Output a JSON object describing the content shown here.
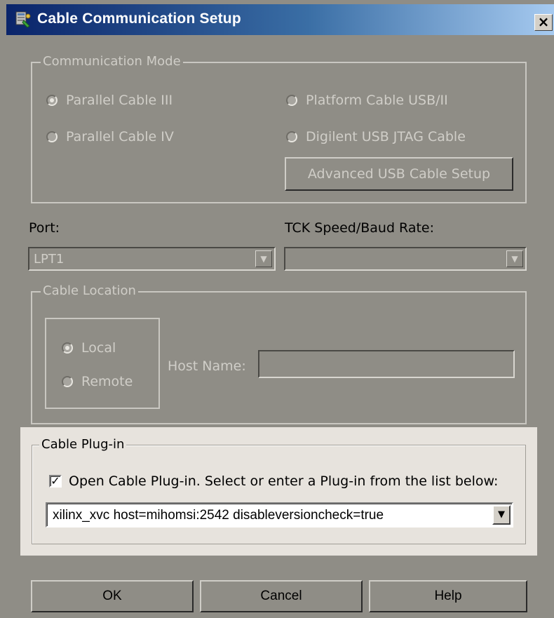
{
  "window": {
    "title": "Cable Communication Setup",
    "close_label": "×"
  },
  "communication_mode": {
    "legend": "Communication Mode",
    "options": [
      {
        "label": "Parallel Cable III",
        "selected": true
      },
      {
        "label": "Parallel Cable IV",
        "selected": false
      },
      {
        "label": "Platform Cable USB/II",
        "selected": false
      },
      {
        "label": "Digilent USB JTAG Cable",
        "selected": false
      }
    ],
    "advanced_button": "Advanced USB Cable Setup"
  },
  "port": {
    "label": "Port:",
    "value": "LPT1"
  },
  "tck_speed": {
    "label": "TCK Speed/Baud Rate:",
    "value": ""
  },
  "cable_location": {
    "legend": "Cable Location",
    "options": [
      {
        "label": "Local",
        "selected": true
      },
      {
        "label": "Remote",
        "selected": false
      }
    ],
    "host_label": "Host Name:",
    "host_value": ""
  },
  "cable_plugin": {
    "legend": "Cable Plug-in",
    "checkbox_label": "Open Cable Plug-in. Select or enter a Plug-in from the list below:",
    "checked": true,
    "value": "xilinx_xvc host=mihomsi:2542 disableversioncheck=true"
  },
  "footer": {
    "ok": "OK",
    "cancel": "Cancel",
    "help": "Help"
  },
  "colors": {
    "dialog_bg": "#8f8d86",
    "active_panel_bg": "#e7e3dd",
    "titlebar_start": "#0a246a",
    "titlebar_end": "#a6caf0"
  }
}
